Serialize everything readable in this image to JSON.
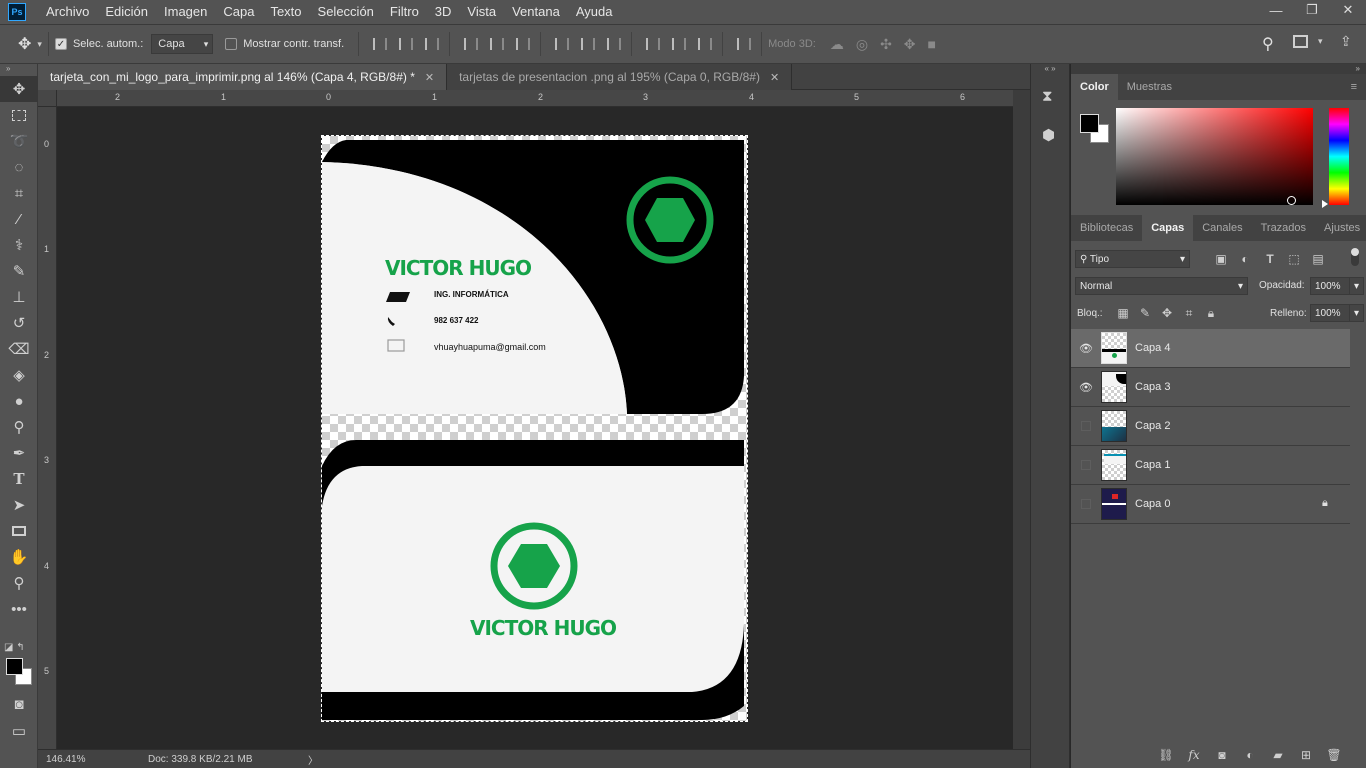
{
  "app": {
    "logo": "Ps"
  },
  "menu": [
    "Archivo",
    "Edición",
    "Imagen",
    "Capa",
    "Texto",
    "Selección",
    "Filtro",
    "3D",
    "Vista",
    "Ventana",
    "Ayuda"
  ],
  "window_controls": {
    "minimize": "—",
    "restore": "❐",
    "close": "✕"
  },
  "options": {
    "auto_select_label": "Selec. autom.:",
    "auto_select_checked": true,
    "target_value": "Capa",
    "show_transform_label": "Mostrar contr. transf.",
    "show_transform_checked": false,
    "mode_3d_label": "Modo 3D:"
  },
  "tabs": [
    {
      "title": "tarjeta_con_mi_logo_para_imprimir.png al 146% (Capa 4, RGB/8#) *",
      "close": "✕",
      "active": true
    },
    {
      "title": "tarjetas de presentacion .png al 195% (Capa 0, RGB/8#)",
      "close": "✕",
      "active": false
    }
  ],
  "rulers": {
    "top": [
      "2",
      "1",
      "0",
      "1",
      "2",
      "3",
      "4",
      "5",
      "6"
    ],
    "left": [
      "0",
      "1",
      "2",
      "3",
      "4",
      "5"
    ]
  },
  "document": {
    "front": {
      "name": "VICTOR HUGO",
      "profession": "ING. INFORMÁTICA",
      "phone": "982 637 422",
      "email": "vhuayhuapuma@gmail.com"
    },
    "back": {
      "name": "VICTOR HUGO"
    },
    "colors": {
      "green": "#16a34a",
      "black": "#000000",
      "card": "#f4f4f4"
    }
  },
  "status": {
    "zoom": "146.41%",
    "doc": "Doc: 339.8 KB/2.21 MB",
    "arrow": "〉"
  },
  "color_panel": {
    "tabs": [
      "Color",
      "Muestras"
    ],
    "foreground": "#000000",
    "background": "#ffffff",
    "hue_color": "#ff0000"
  },
  "layers_panel": {
    "tabs": [
      "Bibliotecas",
      "Capas",
      "Canales",
      "Trazados",
      "Ajustes"
    ],
    "filter_label": "Tipo",
    "blend_mode": "Normal",
    "opacity_label": "Opacidad:",
    "opacity_value": "100%",
    "lock_label": "Bloq.:",
    "fill_label": "Relleno:",
    "fill_value": "100%",
    "layers": [
      {
        "name": "Capa 4",
        "visible": true,
        "selected": true,
        "locked": false
      },
      {
        "name": "Capa 3",
        "visible": true,
        "selected": false,
        "locked": false
      },
      {
        "name": "Capa 2",
        "visible": false,
        "selected": false,
        "locked": false
      },
      {
        "name": "Capa 1",
        "visible": false,
        "selected": false,
        "locked": false
      },
      {
        "name": "Capa 0",
        "visible": false,
        "selected": false,
        "locked": true
      }
    ]
  }
}
